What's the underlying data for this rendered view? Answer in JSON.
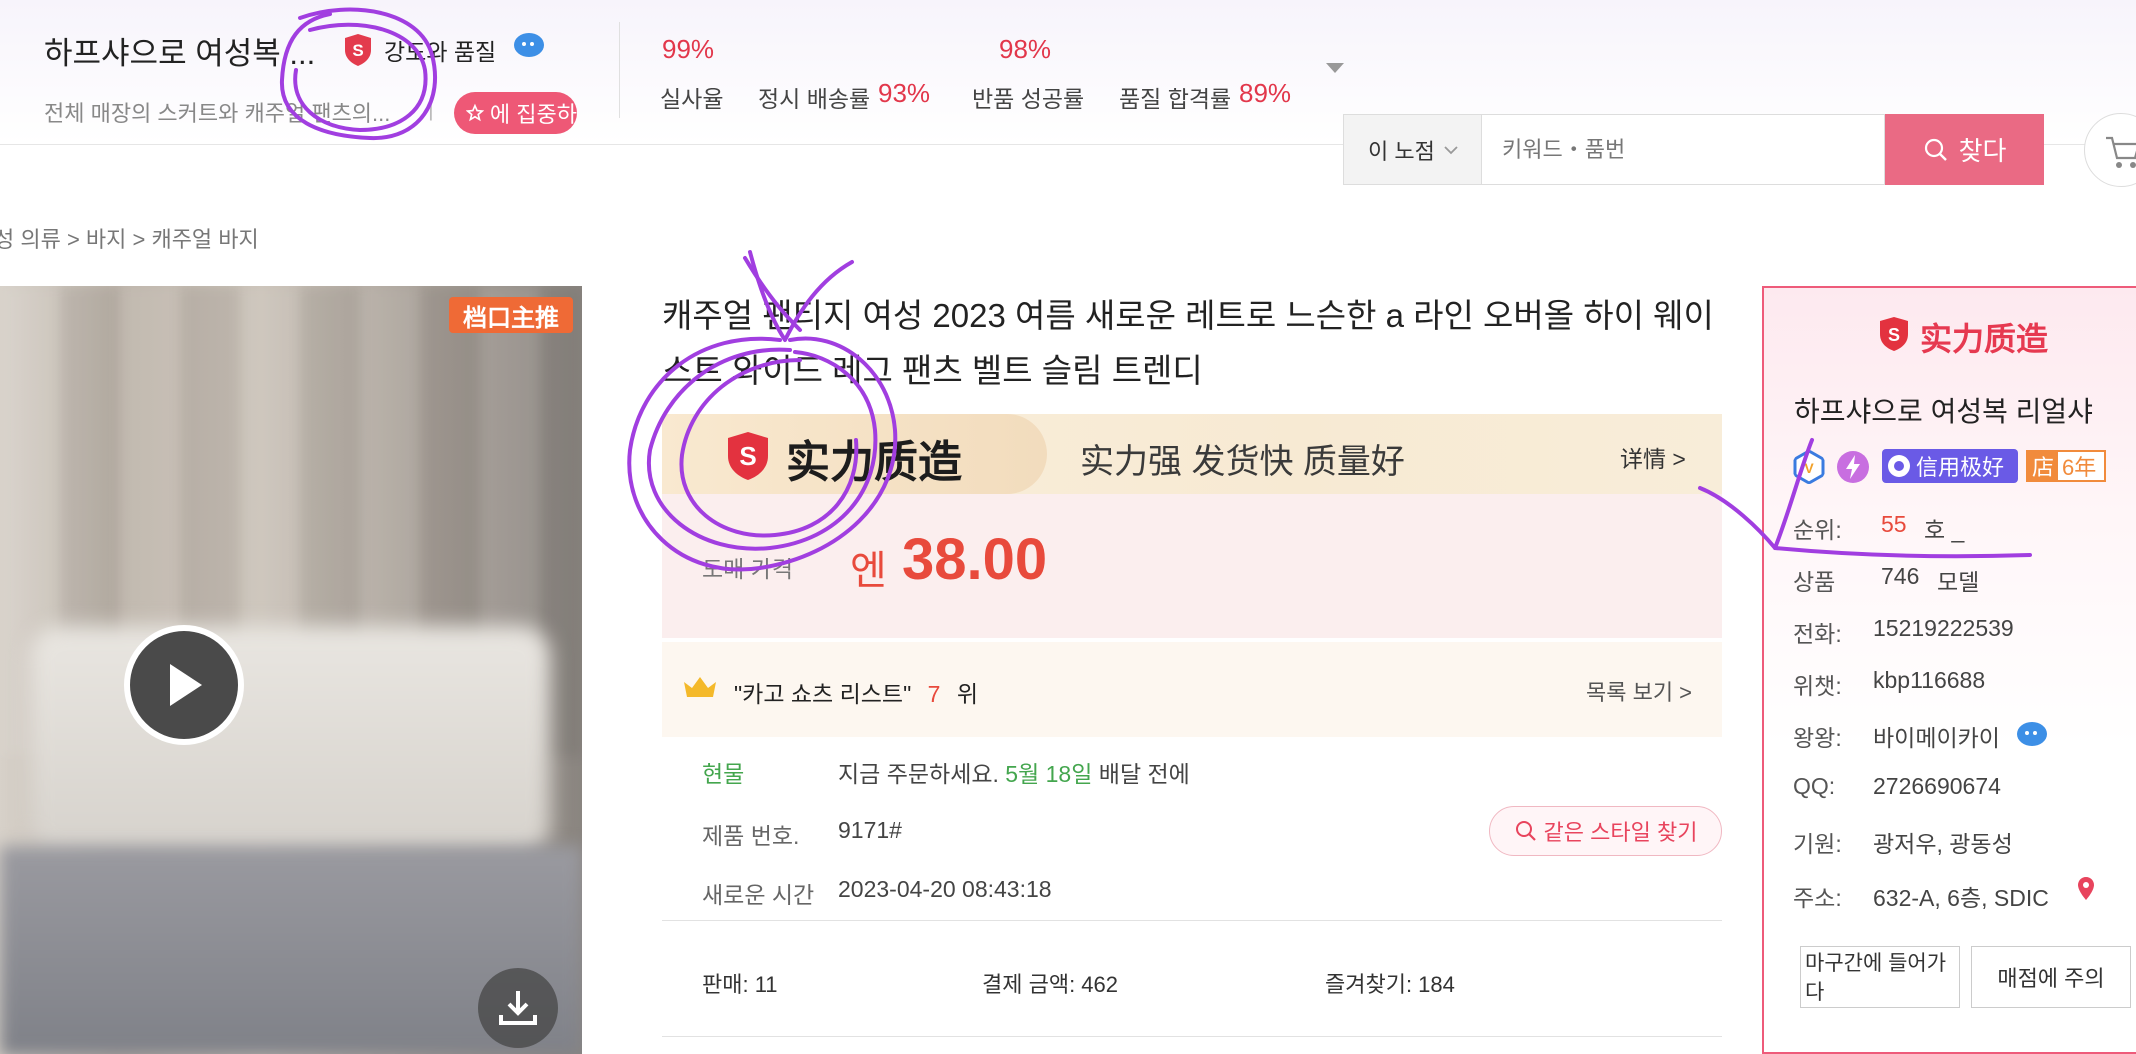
{
  "header": {
    "shop_name": "하프샤으로 여성복 ...",
    "quality_label": "강도와 품질",
    "subtitle": "전체 매장의 스커트와 캐주얼 팬츠의...",
    "pipe": "|",
    "focus_label": "에 집중하",
    "metrics": [
      {
        "value": "99%",
        "label": "실사율"
      },
      {
        "label": "정시 배송률",
        "value": "93%"
      },
      {
        "value": "98%",
        "label": "반품 성공률"
      },
      {
        "label": "품질 합격률",
        "value": "89%"
      }
    ]
  },
  "search": {
    "scope": "이 노점",
    "placeholder": "키워드・품번",
    "button_label": "찾다"
  },
  "breadcrumb": "성 의류 > 바지 > 캐주얼 바지",
  "gallery": {
    "badge": "档口主推"
  },
  "product": {
    "title": "캐주얼 팬티지 여성 2023 여름 새로운 레트로 느슨한 a 라인 오버올 하이 웨이스트 와이드 레그 팬츠 벨트 슬림 트렌디",
    "banner": {
      "s_letter": "S",
      "title": "实力质造",
      "slogan": "实力强  发货快  质量好",
      "more": "详情 >"
    },
    "price_label": "도매 가격",
    "currency": "엔",
    "price": "38.00",
    "rank": {
      "prefix": "\"카고 쇼츠 리스트\"",
      "number": "7",
      "suffix": "위",
      "more": "목록 보기 >"
    },
    "stock": {
      "label": "현물",
      "text_before": "지금 주문하세요.",
      "date": "5월 18일",
      "text_after": "배달 전에"
    },
    "product_no_label": "제품 번호.",
    "product_no": "9171#",
    "same_style_label": "같은 스타일 찾기",
    "new_time_label": "새로운 시간",
    "new_time": "2023-04-20 08:43:18",
    "stats": {
      "sales": "판매: 11",
      "payment": "결제 금액: 462",
      "favorites": "즐겨찾기: 184"
    }
  },
  "shop_panel": {
    "title": "实力质造",
    "name": "하프샤으로 여성복 리얼샤",
    "credit_label": "信用极好",
    "years_prefix": "店",
    "years": "6年",
    "rows": [
      {
        "label": "순위:",
        "value": "55",
        "extra": "호 _"
      },
      {
        "label": "상품",
        "value": "746",
        "extra": "모델"
      },
      {
        "label": "전화:",
        "value": "15219222539"
      },
      {
        "label": "위챗:",
        "value": "kbp116688"
      },
      {
        "label": "왕왕:",
        "value": "바이메이카이"
      },
      {
        "label": "QQ:",
        "value": "2726690674"
      },
      {
        "label": "기원:",
        "value": "광저우, 광동성"
      },
      {
        "label": "주소:",
        "value": "632-A, 6층, SDIC"
      }
    ],
    "enter_label": "마구간에 들어가다",
    "follow_label": "매점에 주의"
  },
  "colors": {
    "accent": "#ee5876",
    "price_red": "#e84a3c",
    "annotation_purple": "#a13ee0",
    "credit_purple": "#6a5ae6"
  }
}
